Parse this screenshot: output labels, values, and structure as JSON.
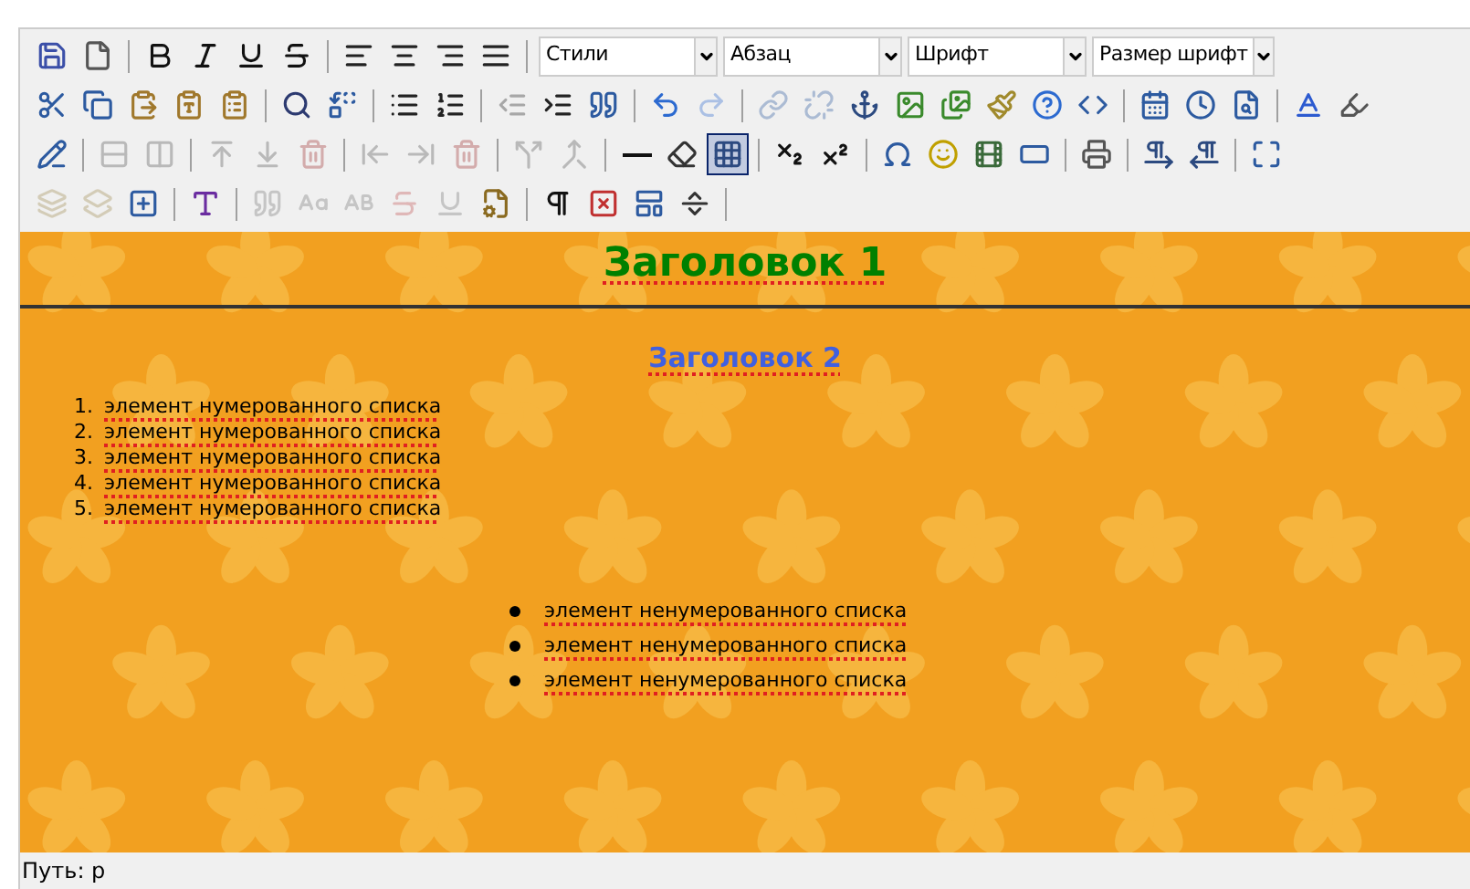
{
  "toolbar": {
    "rows": [
      [
        {
          "kind": "button",
          "disabled": false,
          "selected": false
        },
        {
          "kind": "button",
          "disabled": false,
          "selected": false
        },
        {
          "kind": "separator"
        },
        {
          "kind": "button",
          "disabled": false,
          "selected": false
        },
        {
          "kind": "button",
          "disabled": false,
          "selected": false
        },
        {
          "kind": "button",
          "disabled": false,
          "selected": false
        },
        {
          "kind": "button",
          "disabled": false,
          "selected": false
        },
        {
          "kind": "separator"
        },
        {
          "kind": "button",
          "disabled": false,
          "selected": false
        },
        {
          "kind": "button",
          "disabled": false,
          "selected": false
        },
        {
          "kind": "button",
          "disabled": false,
          "selected": false
        },
        {
          "kind": "button",
          "disabled": false,
          "selected": false
        },
        {
          "kind": "separator"
        },
        {
          "kind": "select",
          "label": "Стили"
        },
        {
          "kind": "select",
          "label": "Абзац"
        },
        {
          "kind": "select",
          "label": "Шрифт"
        },
        {
          "kind": "select",
          "label": "Размер шрифт"
        }
      ],
      [
        {
          "kind": "button",
          "disabled": false,
          "selected": false
        },
        {
          "kind": "button",
          "disabled": false,
          "selected": false
        },
        {
          "kind": "button",
          "disabled": false,
          "selected": false
        },
        {
          "kind": "button",
          "disabled": false,
          "selected": false
        },
        {
          "kind": "button",
          "disabled": false,
          "selected": false
        },
        {
          "kind": "separator"
        },
        {
          "kind": "button",
          "disabled": false,
          "selected": false
        },
        {
          "kind": "button",
          "disabled": false,
          "selected": false
        },
        {
          "kind": "separator"
        },
        {
          "kind": "button",
          "disabled": false,
          "selected": false
        },
        {
          "kind": "button",
          "disabled": false,
          "selected": false
        },
        {
          "kind": "separator"
        },
        {
          "kind": "button",
          "disabled": true,
          "selected": false
        },
        {
          "kind": "button",
          "disabled": false,
          "selected": false
        },
        {
          "kind": "button",
          "disabled": false,
          "selected": false
        },
        {
          "kind": "separator"
        },
        {
          "kind": "button",
          "disabled": false,
          "selected": false
        },
        {
          "kind": "button",
          "disabled": true,
          "selected": false
        },
        {
          "kind": "separator"
        },
        {
          "kind": "button",
          "disabled": true,
          "selected": false
        },
        {
          "kind": "button",
          "disabled": true,
          "selected": false
        },
        {
          "kind": "button",
          "disabled": false,
          "selected": false
        },
        {
          "kind": "button",
          "disabled": false,
          "selected": false
        },
        {
          "kind": "button",
          "disabled": false,
          "selected": false
        },
        {
          "kind": "button",
          "disabled": false,
          "selected": false
        },
        {
          "kind": "button",
          "disabled": false,
          "selected": false
        },
        {
          "kind": "button",
          "disabled": false,
          "selected": false
        },
        {
          "kind": "separator"
        },
        {
          "kind": "button",
          "disabled": false,
          "selected": false
        },
        {
          "kind": "button",
          "disabled": false,
          "selected": false
        },
        {
          "kind": "button",
          "disabled": false,
          "selected": false
        },
        {
          "kind": "separator"
        },
        {
          "kind": "button",
          "disabled": false,
          "selected": false
        },
        {
          "kind": "button",
          "disabled": false,
          "selected": false
        }
      ],
      [
        {
          "kind": "button",
          "disabled": false,
          "selected": false
        },
        {
          "kind": "separator"
        },
        {
          "kind": "button",
          "disabled": true,
          "selected": false
        },
        {
          "kind": "button",
          "disabled": true,
          "selected": false
        },
        {
          "kind": "separator"
        },
        {
          "kind": "button",
          "disabled": true,
          "selected": false
        },
        {
          "kind": "button",
          "disabled": true,
          "selected": false
        },
        {
          "kind": "button",
          "disabled": true,
          "selected": false
        },
        {
          "kind": "separator"
        },
        {
          "kind": "button",
          "disabled": true,
          "selected": false
        },
        {
          "kind": "button",
          "disabled": true,
          "selected": false
        },
        {
          "kind": "button",
          "disabled": true,
          "selected": false
        },
        {
          "kind": "separator"
        },
        {
          "kind": "button",
          "disabled": true,
          "selected": false
        },
        {
          "kind": "button",
          "disabled": true,
          "selected": false
        },
        {
          "kind": "separator"
        },
        {
          "kind": "button",
          "disabled": false,
          "selected": false
        },
        {
          "kind": "button",
          "disabled": false,
          "selected": false
        },
        {
          "kind": "button",
          "disabled": false,
          "selected": true
        },
        {
          "kind": "separator"
        },
        {
          "kind": "button",
          "disabled": false,
          "selected": false
        },
        {
          "kind": "button",
          "disabled": false,
          "selected": false
        },
        {
          "kind": "separator"
        },
        {
          "kind": "button",
          "disabled": false,
          "selected": false
        },
        {
          "kind": "button",
          "disabled": false,
          "selected": false
        },
        {
          "kind": "button",
          "disabled": false,
          "selected": false
        },
        {
          "kind": "button",
          "disabled": false,
          "selected": false
        },
        {
          "kind": "separator"
        },
        {
          "kind": "button",
          "disabled": false,
          "selected": false
        },
        {
          "kind": "separator"
        },
        {
          "kind": "button",
          "disabled": false,
          "selected": false
        },
        {
          "kind": "button",
          "disabled": false,
          "selected": false
        },
        {
          "kind": "separator"
        },
        {
          "kind": "button",
          "disabled": false,
          "selected": false
        }
      ],
      [
        {
          "kind": "button",
          "disabled": true,
          "selected": false
        },
        {
          "kind": "button",
          "disabled": true,
          "selected": false
        },
        {
          "kind": "button",
          "disabled": false,
          "selected": false
        },
        {
          "kind": "separator"
        },
        {
          "kind": "button",
          "disabled": false,
          "selected": false
        },
        {
          "kind": "separator"
        },
        {
          "kind": "button",
          "disabled": true,
          "selected": false
        },
        {
          "kind": "button",
          "disabled": true,
          "selected": false
        },
        {
          "kind": "button",
          "disabled": true,
          "selected": false
        },
        {
          "kind": "button",
          "disabled": true,
          "selected": false
        },
        {
          "kind": "button",
          "disabled": true,
          "selected": false
        },
        {
          "kind": "button",
          "disabled": false,
          "selected": false
        },
        {
          "kind": "separator"
        },
        {
          "kind": "button",
          "disabled": false,
          "selected": false
        },
        {
          "kind": "button",
          "disabled": false,
          "selected": false
        },
        {
          "kind": "button",
          "disabled": false,
          "selected": false
        },
        {
          "kind": "button",
          "disabled": false,
          "selected": false
        },
        {
          "kind": "separator"
        }
      ]
    ]
  },
  "content": {
    "heading_1": "Заголовок 1",
    "heading_2": "Заголовок 2",
    "numbered_list": [
      {
        "number": "1.",
        "text": "элемент нумерованного списка"
      },
      {
        "number": "2.",
        "text": "элемент нумерованного списка"
      },
      {
        "number": "3.",
        "text": "элемент нумерованного списка"
      },
      {
        "number": "4.",
        "text": "элемент нумерованного списка"
      },
      {
        "number": "5.",
        "text": "элемент нумерованного списка"
      }
    ],
    "bulleted_list": [
      "элемент ненумерованного списка",
      "элемент ненумерованного списка",
      "элемент ненумерованного списка"
    ]
  },
  "status_bar": {
    "path": "Путь: p"
  }
}
